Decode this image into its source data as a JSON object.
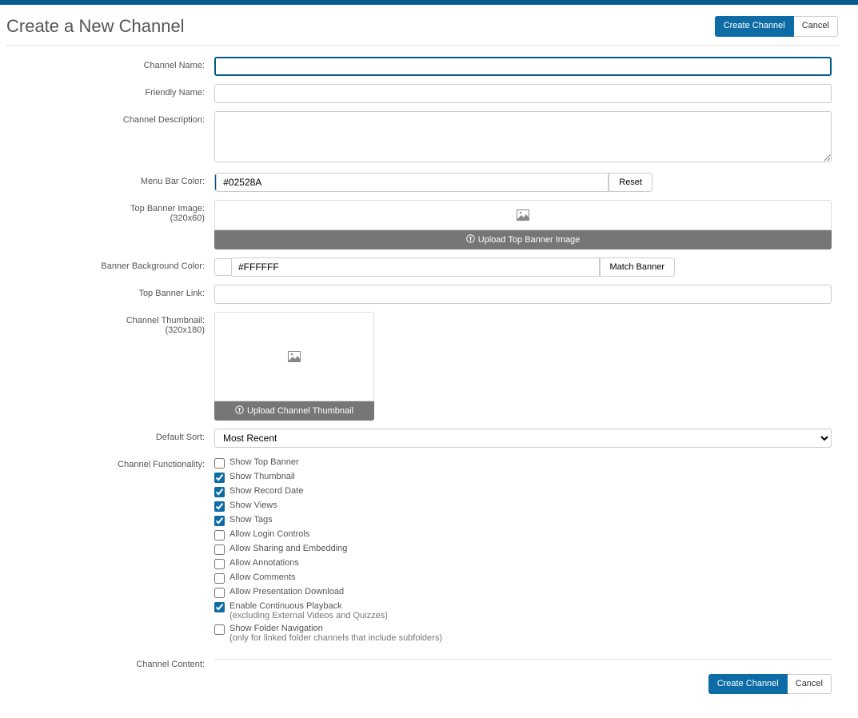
{
  "page": {
    "title": "Create a New Channel",
    "create_button": "Create Channel",
    "cancel_button": "Cancel"
  },
  "labels": {
    "channel_name": "Channel Name:",
    "friendly_name": "Friendly Name:",
    "channel_description": "Channel Description:",
    "menu_bar_color": "Menu Bar Color:",
    "top_banner_image": "Top Banner Image:",
    "top_banner_image_sub": "(320x60)",
    "banner_bg_color": "Banner Background Color:",
    "top_banner_link": "Top Banner Link:",
    "channel_thumbnail": "Channel Thumbnail:",
    "channel_thumbnail_sub": "(320x180)",
    "default_sort": "Default Sort:",
    "channel_functionality": "Channel Functionality:",
    "channel_content": "Channel Content:"
  },
  "values": {
    "channel_name": "",
    "friendly_name": "",
    "channel_description": "",
    "menu_bar_color": "#02528A",
    "banner_bg_color": "#FFFFFF",
    "top_banner_link": "",
    "default_sort": "Most Recent"
  },
  "buttons": {
    "reset": "Reset",
    "match_banner": "Match Banner",
    "upload_top_banner": "Upload Top Banner Image",
    "upload_thumbnail": "Upload Channel Thumbnail"
  },
  "functionality": [
    {
      "label": "Show Top Banner",
      "checked": false,
      "sub": ""
    },
    {
      "label": "Show Thumbnail",
      "checked": true,
      "sub": ""
    },
    {
      "label": "Show Record Date",
      "checked": true,
      "sub": ""
    },
    {
      "label": "Show Views",
      "checked": true,
      "sub": ""
    },
    {
      "label": "Show Tags",
      "checked": true,
      "sub": ""
    },
    {
      "label": "Allow Login Controls",
      "checked": false,
      "sub": ""
    },
    {
      "label": "Allow Sharing and Embedding",
      "checked": false,
      "sub": ""
    },
    {
      "label": "Allow Annotations",
      "checked": false,
      "sub": ""
    },
    {
      "label": "Allow Comments",
      "checked": false,
      "sub": ""
    },
    {
      "label": "Allow Presentation Download",
      "checked": false,
      "sub": ""
    },
    {
      "label": "Enable Continuous Playback",
      "checked": true,
      "sub": "(excluding External Videos and Quizzes)"
    },
    {
      "label": "Show Folder Navigation",
      "checked": false,
      "sub": "(only for linked folder channels that include subfolders)"
    }
  ]
}
